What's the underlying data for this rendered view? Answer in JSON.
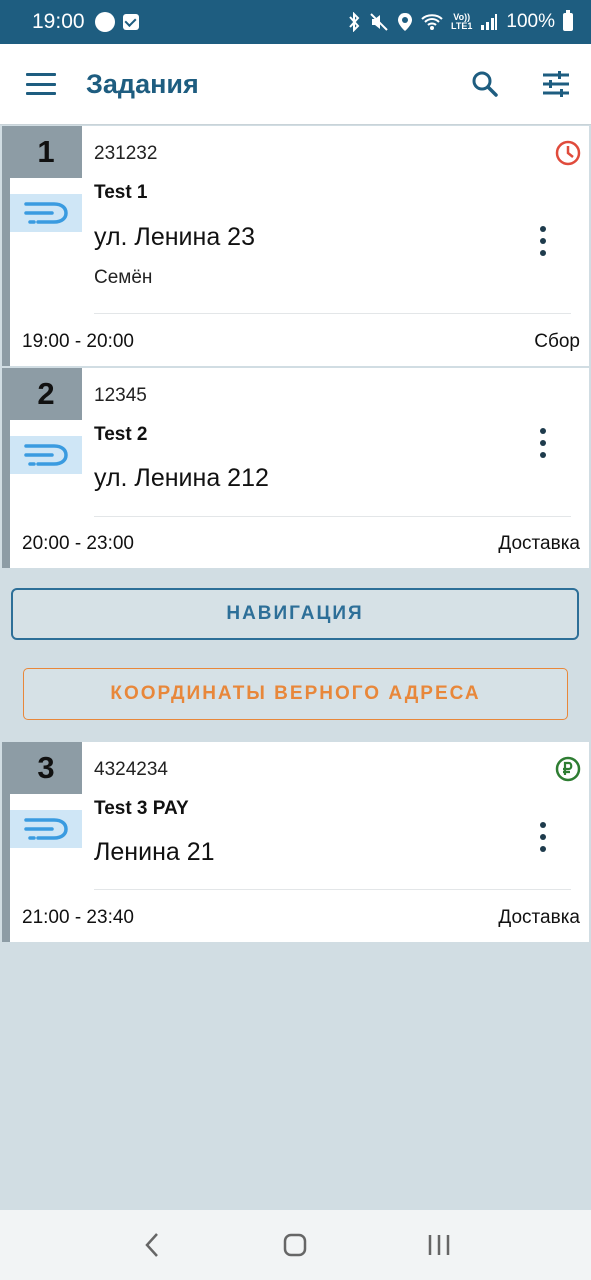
{
  "status_bar": {
    "time": "19:00",
    "battery": "100%",
    "icons": [
      "circle-icon",
      "checkbox-icon",
      "bluetooth-icon",
      "mute-icon",
      "location-icon",
      "wifi-icon",
      "volte-icon",
      "signal-icon",
      "battery-icon"
    ],
    "volte_top": "Vo))",
    "volte_bottom": "LTE1"
  },
  "app_bar": {
    "title": "Задания",
    "icons": [
      "menu-icon",
      "search-icon",
      "filter-icon"
    ],
    "accent": "#1e5d80"
  },
  "tasks": [
    {
      "number": "1",
      "id": "231232",
      "name": "Test 1",
      "address": "ул. Ленина 23",
      "person": "Семён",
      "time": "19:00 - 20:00",
      "type": "Сбор",
      "badge": "clock-icon",
      "badge_color": "#e04b3c"
    },
    {
      "number": "2",
      "id": "12345",
      "name": "Test 2",
      "address": "ул. Ленина 212",
      "person": "",
      "time": "20:00 - 23:00",
      "type": "Доставка",
      "badge": "",
      "badge_color": ""
    },
    {
      "number": "3",
      "id": "4324234",
      "name": "Test 3 PAY",
      "address": "Ленина 21",
      "person": "",
      "time": "21:00 - 23:40",
      "type": "Доставка",
      "badge": "ruble-icon",
      "badge_color": "#2e7d32"
    }
  ],
  "buttons": {
    "navigation": "НАВИГАЦИЯ",
    "coordinates": "КООРДИНАТЫ ВЕРНОГО АДРЕСА",
    "navigation_color": "#2d6f98",
    "coordinates_color": "#e8873a"
  },
  "bottom_nav": {
    "icons": [
      "back-icon",
      "home-icon",
      "recents-icon"
    ]
  }
}
